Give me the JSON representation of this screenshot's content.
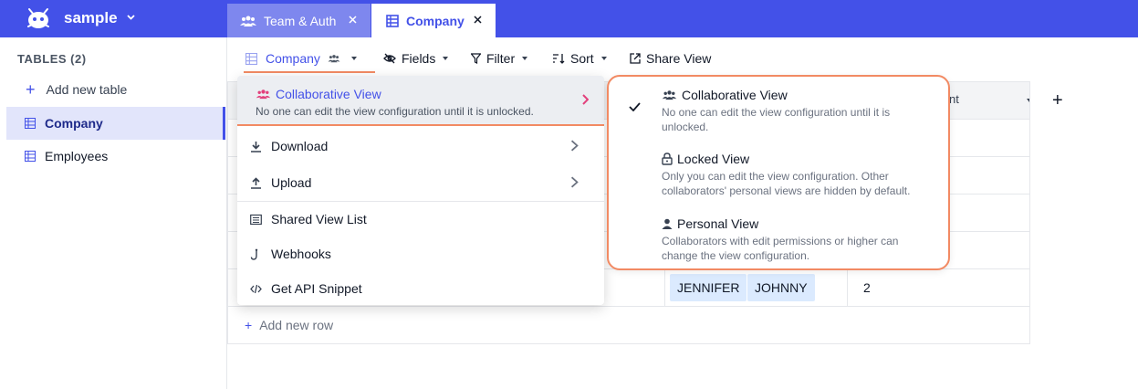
{
  "workspace": {
    "name": "sample"
  },
  "tabs": [
    {
      "label": "Team & Auth",
      "icon": "team-icon",
      "active": false
    },
    {
      "label": "Company",
      "icon": "table-icon",
      "active": true
    }
  ],
  "sidebar": {
    "title": "TABLES (2)",
    "add_label": "Add new table",
    "items": [
      {
        "label": "Company",
        "active": true
      },
      {
        "label": "Employees",
        "active": false
      }
    ]
  },
  "toolbar": {
    "view_label": "Company",
    "fields_label": "Fields",
    "filter_label": "Filter",
    "sort_label": "Sort",
    "share_label": "Share View"
  },
  "grid": {
    "column_header_partial": "nt",
    "add_row_label": "Add new row",
    "visible_cells": {
      "chips": [
        "JENNIFER",
        "JOHNNY"
      ],
      "count": "2"
    }
  },
  "view_menu": {
    "collaborative": {
      "title": "Collaborative View",
      "description": "No one can edit the view configuration until it is unlocked."
    },
    "items": [
      {
        "label": "Download",
        "icon": "download-icon",
        "has_submenu": true
      },
      {
        "label": "Upload",
        "icon": "upload-icon",
        "has_submenu": true
      },
      {
        "label": "Shared View List",
        "icon": "list-icon",
        "has_submenu": false
      },
      {
        "label": "Webhooks",
        "icon": "webhook-icon",
        "has_submenu": false
      },
      {
        "label": "Get API Snippet",
        "icon": "code-icon",
        "has_submenu": false
      }
    ]
  },
  "lock_submenu": {
    "options": [
      {
        "title": "Collaborative View",
        "description": "No one can edit the view configuration until it is unlocked.",
        "selected": true,
        "icon": "users-icon"
      },
      {
        "title": "Locked View",
        "description": "Only you can edit the view configuration. Other collaborators' personal views are hidden by default.",
        "selected": false,
        "icon": "lock-icon"
      },
      {
        "title": "Personal View",
        "description": "Collaborators with edit permissions or higher can change the view configuration.",
        "selected": false,
        "icon": "person-icon"
      }
    ]
  },
  "colors": {
    "brand": "#4351e8",
    "accent": "#f28a63",
    "collab_icon": "#e2407c"
  }
}
